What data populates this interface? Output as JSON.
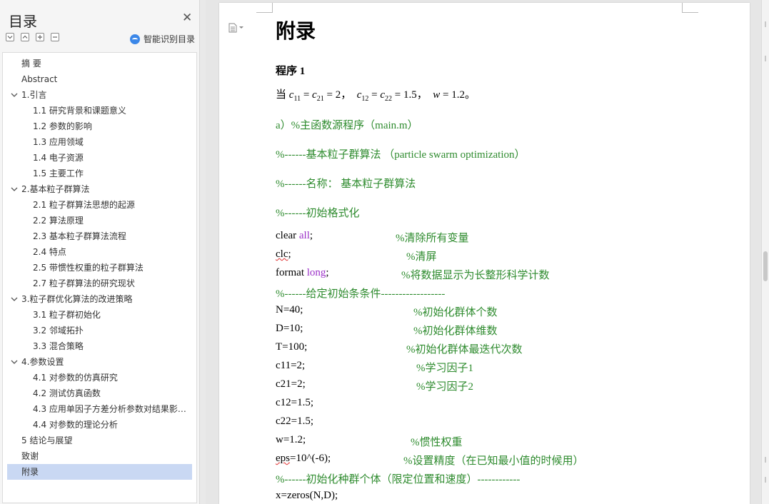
{
  "toc": {
    "title": "目录",
    "smart_label": "智能识别目录",
    "items": [
      {
        "label": "摘  要",
        "level": 0,
        "chevron": false
      },
      {
        "label": "Abstract",
        "level": 0,
        "chevron": false
      },
      {
        "label": "1.引言",
        "level": 0,
        "chevron": true
      },
      {
        "label": "1.1  研究背景和课题意义",
        "level": 1
      },
      {
        "label": "1.2  参数的影响",
        "level": 1
      },
      {
        "label": "1.3  应用领域",
        "level": 1
      },
      {
        "label": "1.4  电子资源",
        "level": 1
      },
      {
        "label": "1.5  主要工作",
        "level": 1
      },
      {
        "label": "2.基本粒子群算法",
        "level": 0,
        "chevron": true
      },
      {
        "label": "2.1  粒子群算法思想的起源",
        "level": 1
      },
      {
        "label": "2.2  算法原理",
        "level": 1
      },
      {
        "label": "2.3  基本粒子群算法流程",
        "level": 1
      },
      {
        "label": "2.4  特点",
        "level": 1
      },
      {
        "label": "2.5  带惯性权重的粒子群算法",
        "level": 1
      },
      {
        "label": "2.7  粒子群算法的研究现状",
        "level": 1
      },
      {
        "label": "3.粒子群优化算法的改进策略",
        "level": 0,
        "chevron": true
      },
      {
        "label": "3.1  粒子群初始化",
        "level": 1
      },
      {
        "label": "3.2  邻域拓扑",
        "level": 1
      },
      {
        "label": "3.3  混合策略",
        "level": 1
      },
      {
        "label": "4.参数设置",
        "level": 0,
        "chevron": true
      },
      {
        "label": "4.1  对参数的仿真研究",
        "level": 1
      },
      {
        "label": "4.2  测试仿真函数",
        "level": 1
      },
      {
        "label": "4.3  应用单因子方差分析参数对结果影响...",
        "level": 1
      },
      {
        "label": "4.4  对参数的理论分析",
        "level": 1
      },
      {
        "label": "5 结论与展望",
        "level": 0,
        "chevron": false
      },
      {
        "label": "致谢",
        "level": 0,
        "chevron": false
      },
      {
        "label": "附录",
        "level": 0,
        "chevron": false,
        "selected": true
      }
    ]
  },
  "doc": {
    "heading": "附录",
    "program_title": "程序 1",
    "formula": {
      "prefix": "当",
      "c11": "c",
      "c11_sub": "11",
      "c21_sub": "21",
      "val1": "2",
      "c12_sub": "12",
      "c22_sub": "22",
      "val2": "1.5",
      "w": "w",
      "val3": "1.2"
    },
    "lines": {
      "a": "a）%主函数源程序（main.m）",
      "b": "%------基本粒子群算法  （particle swarm optimization）",
      "c": "%------名称：  基本粒子群算法",
      "d": "%------初始格式化",
      "clear_kw": "clear",
      "clear_arg": "all",
      "clear_end": ";",
      "clear_cmt": "%清除所有变量",
      "clc": "clc",
      "clc_end": ";",
      "clc_cmt": "%清屏",
      "format_kw": "format",
      "format_arg": "long",
      "format_end": ";",
      "format_cmt": "%将数据显示为长整形科学计数",
      "init_cond": "%------给定初始条条件------------------",
      "n": "N=40;",
      "n_cmt": "%初始化群体个数",
      "d_line": "D=10;",
      "d_cmt": "%初始化群体维数",
      "t": "T=100;",
      "t_cmt": "%初始化群体最迭代次数",
      "c11": "c11=2;",
      "c11_cmt": "%学习因子1",
      "c21": "c21=2;",
      "c21_cmt": "%学习因子2",
      "c12": "c12=1.5;",
      "c22": "c22=1.5;",
      "w": "w=1.2;",
      "w_cmt": "%惯性权重",
      "eps_kw": "eps",
      "eps_rest": "=10^(-6);",
      "eps_cmt": "%设置精度（在已知最小值的时候用）",
      "init_pop": "%------初始化种群个体（限定位置和速度）------------",
      "x": "x=zeros(N,D);"
    }
  }
}
